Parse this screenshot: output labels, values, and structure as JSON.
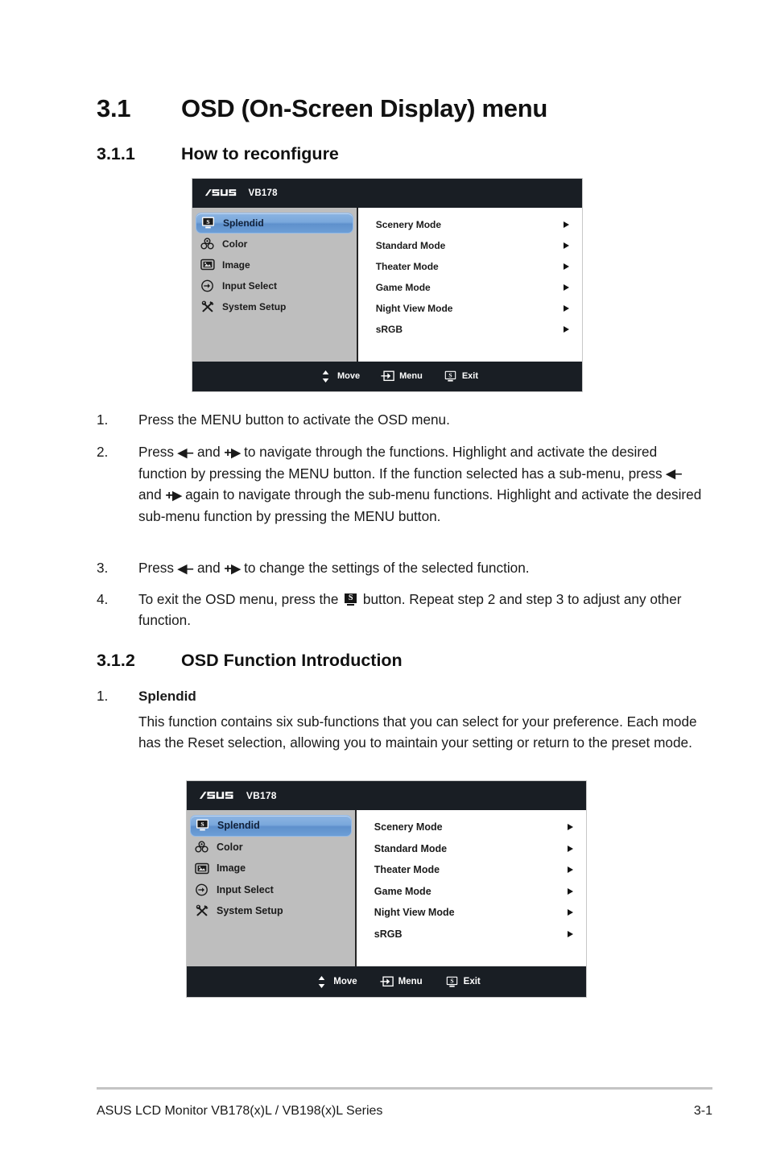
{
  "sections": {
    "h1": {
      "number": "3.1",
      "title": "OSD (On-Screen Display) menu"
    },
    "h2_first": {
      "number": "3.1.1",
      "title": "How to reconfigure"
    },
    "h2_second": {
      "number": "3.1.2",
      "title": "OSD Function Introduction"
    }
  },
  "steps": [
    {
      "num": "1.",
      "text_a": "Press the MENU button to activate the OSD menu."
    },
    {
      "num": "2.",
      "text_a": "Press ",
      "text_b": " and ",
      "text_c": " to navigate through the functions. Highlight and activate the desired function by pressing the MENU button. If the function selected has a sub-menu, press ",
      "text_d": " and ",
      "text_e": " again to navigate through the sub-menu functions. Highlight and activate the desired sub-menu function by pressing the MENU button."
    },
    {
      "num": "3.",
      "text_a": "Press ",
      "text_b": " and ",
      "text_c": " to change the settings of the selected function."
    },
    {
      "num": "4.",
      "text_a": "To exit the OSD menu, press the ",
      "text_b": " button. Repeat step 2 and step 3 to adjust any other function."
    }
  ],
  "glyphs": {
    "left_minus_tri": "◀",
    "left_minus_dash": "–",
    "plus_right_plus": "+",
    "plus_right_tri": "▶"
  },
  "function_intro": {
    "num": "1.",
    "name": "Splendid",
    "description": "This function contains six sub-functions that you can select for your preference. Each mode has the Reset selection, allowing you to maintain your setting or return to the preset mode."
  },
  "osd": {
    "brand": "ASUS",
    "model": "VB178",
    "sidebar": [
      {
        "label": "Splendid",
        "icon": "splendid-monitor-icon",
        "selected": true
      },
      {
        "label": "Color",
        "icon": "color-circles-icon",
        "selected": false
      },
      {
        "label": "Image",
        "icon": "image-picture-icon",
        "selected": false
      },
      {
        "label": "Input Select",
        "icon": "input-arrow-circle-icon",
        "selected": false
      },
      {
        "label": "System Setup",
        "icon": "tools-icon",
        "selected": false
      }
    ],
    "options": [
      {
        "label": "Scenery Mode"
      },
      {
        "label": "Standard Mode"
      },
      {
        "label": "Theater Mode"
      },
      {
        "label": "Game Mode"
      },
      {
        "label": "Night View Mode"
      },
      {
        "label": "sRGB"
      }
    ],
    "footer": [
      {
        "label": "Move",
        "icon": "up-down-arrows-icon"
      },
      {
        "label": "Menu",
        "icon": "menu-enter-icon"
      },
      {
        "label": "Exit",
        "icon": "splendid-monitor-icon"
      }
    ],
    "colors": {
      "titlebar": "#191e24",
      "sidebar_bg": "#bebebe",
      "panel_bg": "#ffffff",
      "highlight_blue": "#6d9ed6"
    }
  },
  "page": {
    "footer_text": "ASUS LCD Monitor VB178(x)L / VB198(x)L Series",
    "page_number": "3-1"
  }
}
